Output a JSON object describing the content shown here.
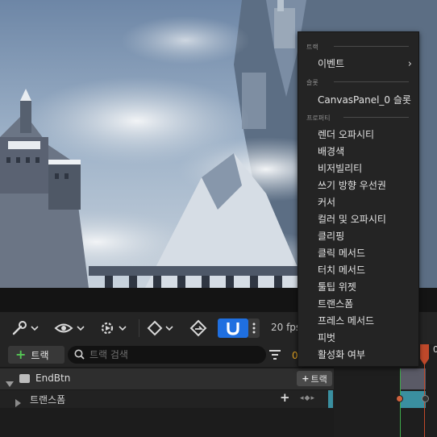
{
  "toolbar": {
    "fps_label": "20 fps",
    "snap_color": "#1f6fe0"
  },
  "search_row": {
    "add_track_label": "트랙",
    "search_placeholder": "트랙 검색",
    "time_partial": "0"
  },
  "tracks": [
    {
      "name": "EndBtn",
      "add_label": "트랙"
    },
    {
      "name": "트랜스폼",
      "key_nav": "◂◆▸"
    }
  ],
  "timeline": {
    "ruler_partial": "0"
  },
  "context_menu": {
    "sections": [
      {
        "title": "트랙",
        "items": [
          {
            "label": "이벤트",
            "submenu": "›"
          }
        ]
      },
      {
        "title": "슬롯",
        "items": [
          {
            "label": "CanvasPanel_0 슬롯"
          }
        ]
      },
      {
        "title": "프로퍼티",
        "items": [
          {
            "label": "렌더 오파시티"
          },
          {
            "label": "배경색"
          },
          {
            "label": "비저빌리티"
          },
          {
            "label": "쓰기 방향 우선권"
          },
          {
            "label": "커서"
          },
          {
            "label": "컬러 및 오파시티"
          },
          {
            "label": "클리핑"
          },
          {
            "label": "클릭 메서드"
          },
          {
            "label": "터치 메서드"
          },
          {
            "label": "툴팁 위젯"
          },
          {
            "label": "트랜스폼"
          },
          {
            "label": "프레스 메서드"
          },
          {
            "label": "피벗"
          },
          {
            "label": "활성화 여부"
          }
        ]
      }
    ]
  }
}
